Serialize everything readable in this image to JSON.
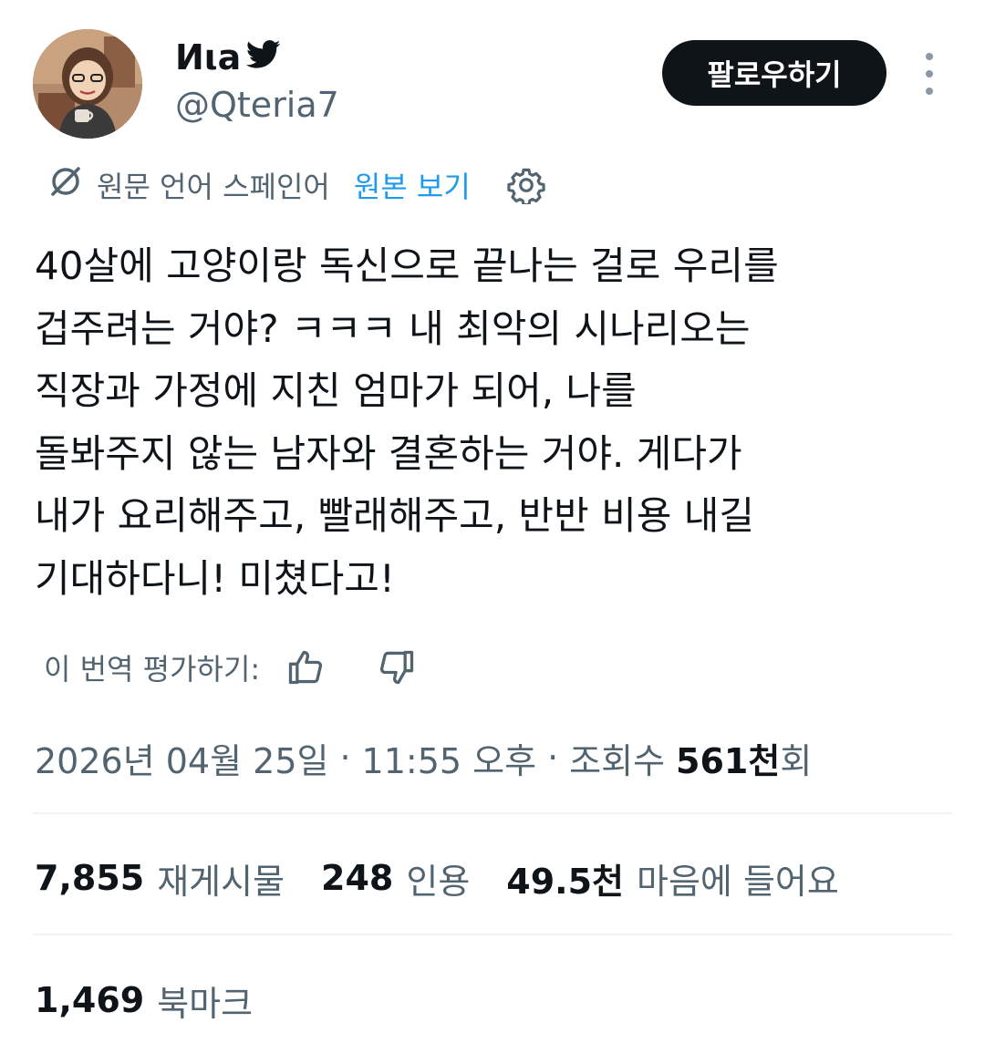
{
  "author": {
    "display_name": "Иιa",
    "handle": "@Qteria7",
    "verified_icon": "bird-icon"
  },
  "follow_button": {
    "label": "팔로우하기"
  },
  "translation": {
    "source_language": "원문 언어 스페인어",
    "show_original": "원본 보기"
  },
  "tweet": {
    "lines": [
      "40살에 고양이랑 독신으로 끝나는 걸로 우리를",
      "겁주려는 거야? ㅋㅋㅋ 내 최악의 시나리오는",
      "직장과 가정에 지친 엄마가 되어, 나를",
      "돌봐주지 않는 남자와 결혼하는 거야. 게다가",
      "내가 요리해주고, 빨래해주고, 반반 비용 내길",
      "기대하다니! 미쳤다고!"
    ]
  },
  "rating": {
    "label": "이 번역 평가하기:"
  },
  "meta": {
    "date": "2026년 04월 25일",
    "separator": "·",
    "time": "11:55 오후",
    "views_label": "조회수",
    "views_value": "561천",
    "views_suffix": "회"
  },
  "stats": {
    "reposts": {
      "value": "7,855",
      "label": "재게시물"
    },
    "quotes": {
      "value": "248",
      "label": "인용"
    },
    "likes": {
      "value": "49.5천",
      "label": "마음에 들어요"
    },
    "bookmarks": {
      "value": "1,469",
      "label": "북마크"
    }
  },
  "colors": {
    "text": "#0f1419",
    "secondary": "#536471",
    "link": "#1d9bf0",
    "button_bg": "#0f1419",
    "divider": "#eff3f4"
  }
}
